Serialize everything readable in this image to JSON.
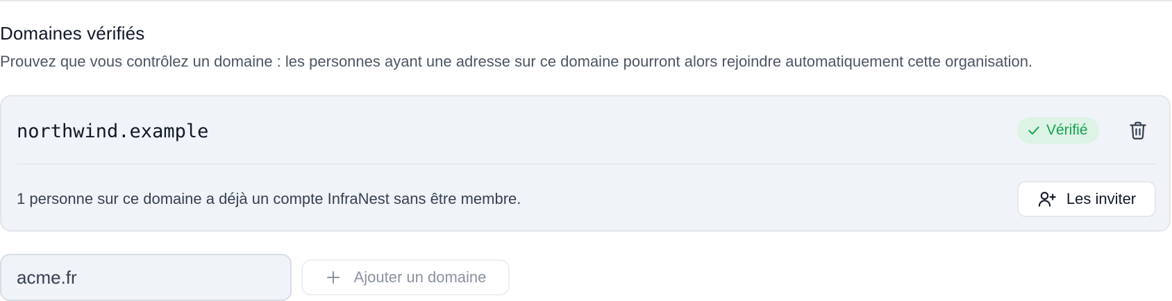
{
  "section": {
    "title": "Domaines vérifiés",
    "description": "Prouvez que vous contrôlez un domaine : les personnes ayant une adresse sur ce domaine pourront alors rejoindre automatiquement cette organisation."
  },
  "domains": [
    {
      "name": "northwind.example",
      "status_label": "Vérifié",
      "status_icon": "check-icon",
      "delete_icon": "trash-icon",
      "pending_members_text": "1 personne sur ce domaine a déjà un compte InfraNest sans être membre.",
      "invite_label": "Les inviter",
      "invite_icon": "user-plus-icon"
    }
  ],
  "new_domain": {
    "value": "acme.fr",
    "add_label": "Ajouter un domaine",
    "add_icon": "plus-icon"
  },
  "colors": {
    "verified_text": "#16a34a",
    "verified_bg": "#dcf3e6",
    "card_bg": "#f0f3f7"
  }
}
